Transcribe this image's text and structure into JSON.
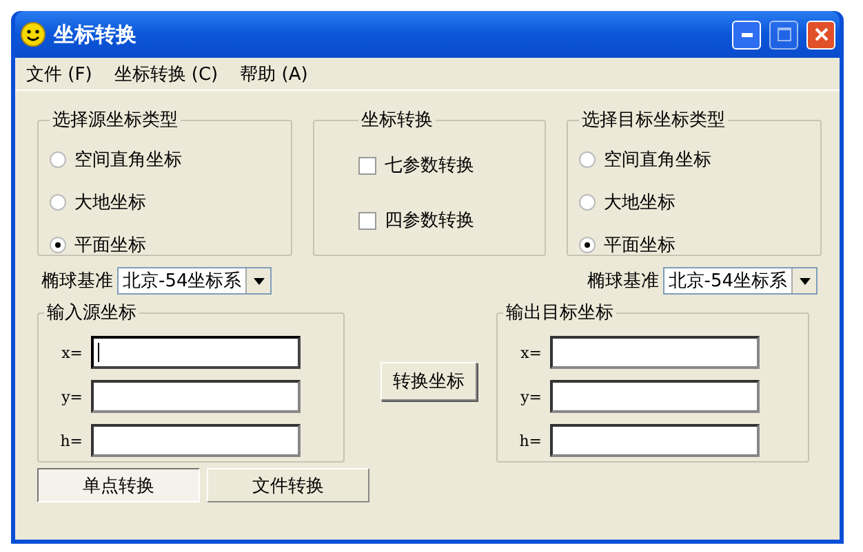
{
  "window": {
    "title": "坐标转换"
  },
  "menu": [
    {
      "label": "文件",
      "key": "(F)"
    },
    {
      "label": "坐标转换",
      "key": "(C)"
    },
    {
      "label": "帮助",
      "key": "(A)"
    }
  ],
  "source_type": {
    "title": "选择源坐标类型",
    "options": [
      {
        "label": "空间直角坐标",
        "selected": false
      },
      {
        "label": "大地坐标",
        "selected": false
      },
      {
        "label": "平面坐标",
        "selected": true
      }
    ]
  },
  "conversion": {
    "title": "坐标转换",
    "options": [
      {
        "label": "七参数转换",
        "checked": false
      },
      {
        "label": "四参数转换",
        "checked": false
      }
    ]
  },
  "target_type": {
    "title": "选择目标坐标类型",
    "options": [
      {
        "label": "空间直角坐标",
        "selected": false
      },
      {
        "label": "大地坐标",
        "selected": false
      },
      {
        "label": "平面坐标",
        "selected": true
      }
    ]
  },
  "source_ellipsoid": {
    "label": "椭球基准",
    "value": "北京-54坐标系"
  },
  "target_ellipsoid": {
    "label": "椭球基准",
    "value": "北京-54坐标系"
  },
  "input": {
    "title": "输入源坐标",
    "fields": [
      {
        "label": "x=",
        "focused": true
      },
      {
        "label": "y=",
        "focused": false
      },
      {
        "label": "h=",
        "focused": false
      }
    ]
  },
  "convert_button": "转换坐标",
  "output": {
    "title": "输出目标坐标",
    "fields": [
      {
        "label": "x=",
        "focused": false
      },
      {
        "label": "y=",
        "focused": false
      },
      {
        "label": "h=",
        "focused": false
      }
    ]
  },
  "tabs": [
    {
      "label": "单点转换",
      "selected": true
    },
    {
      "label": "文件转换",
      "selected": false
    }
  ]
}
